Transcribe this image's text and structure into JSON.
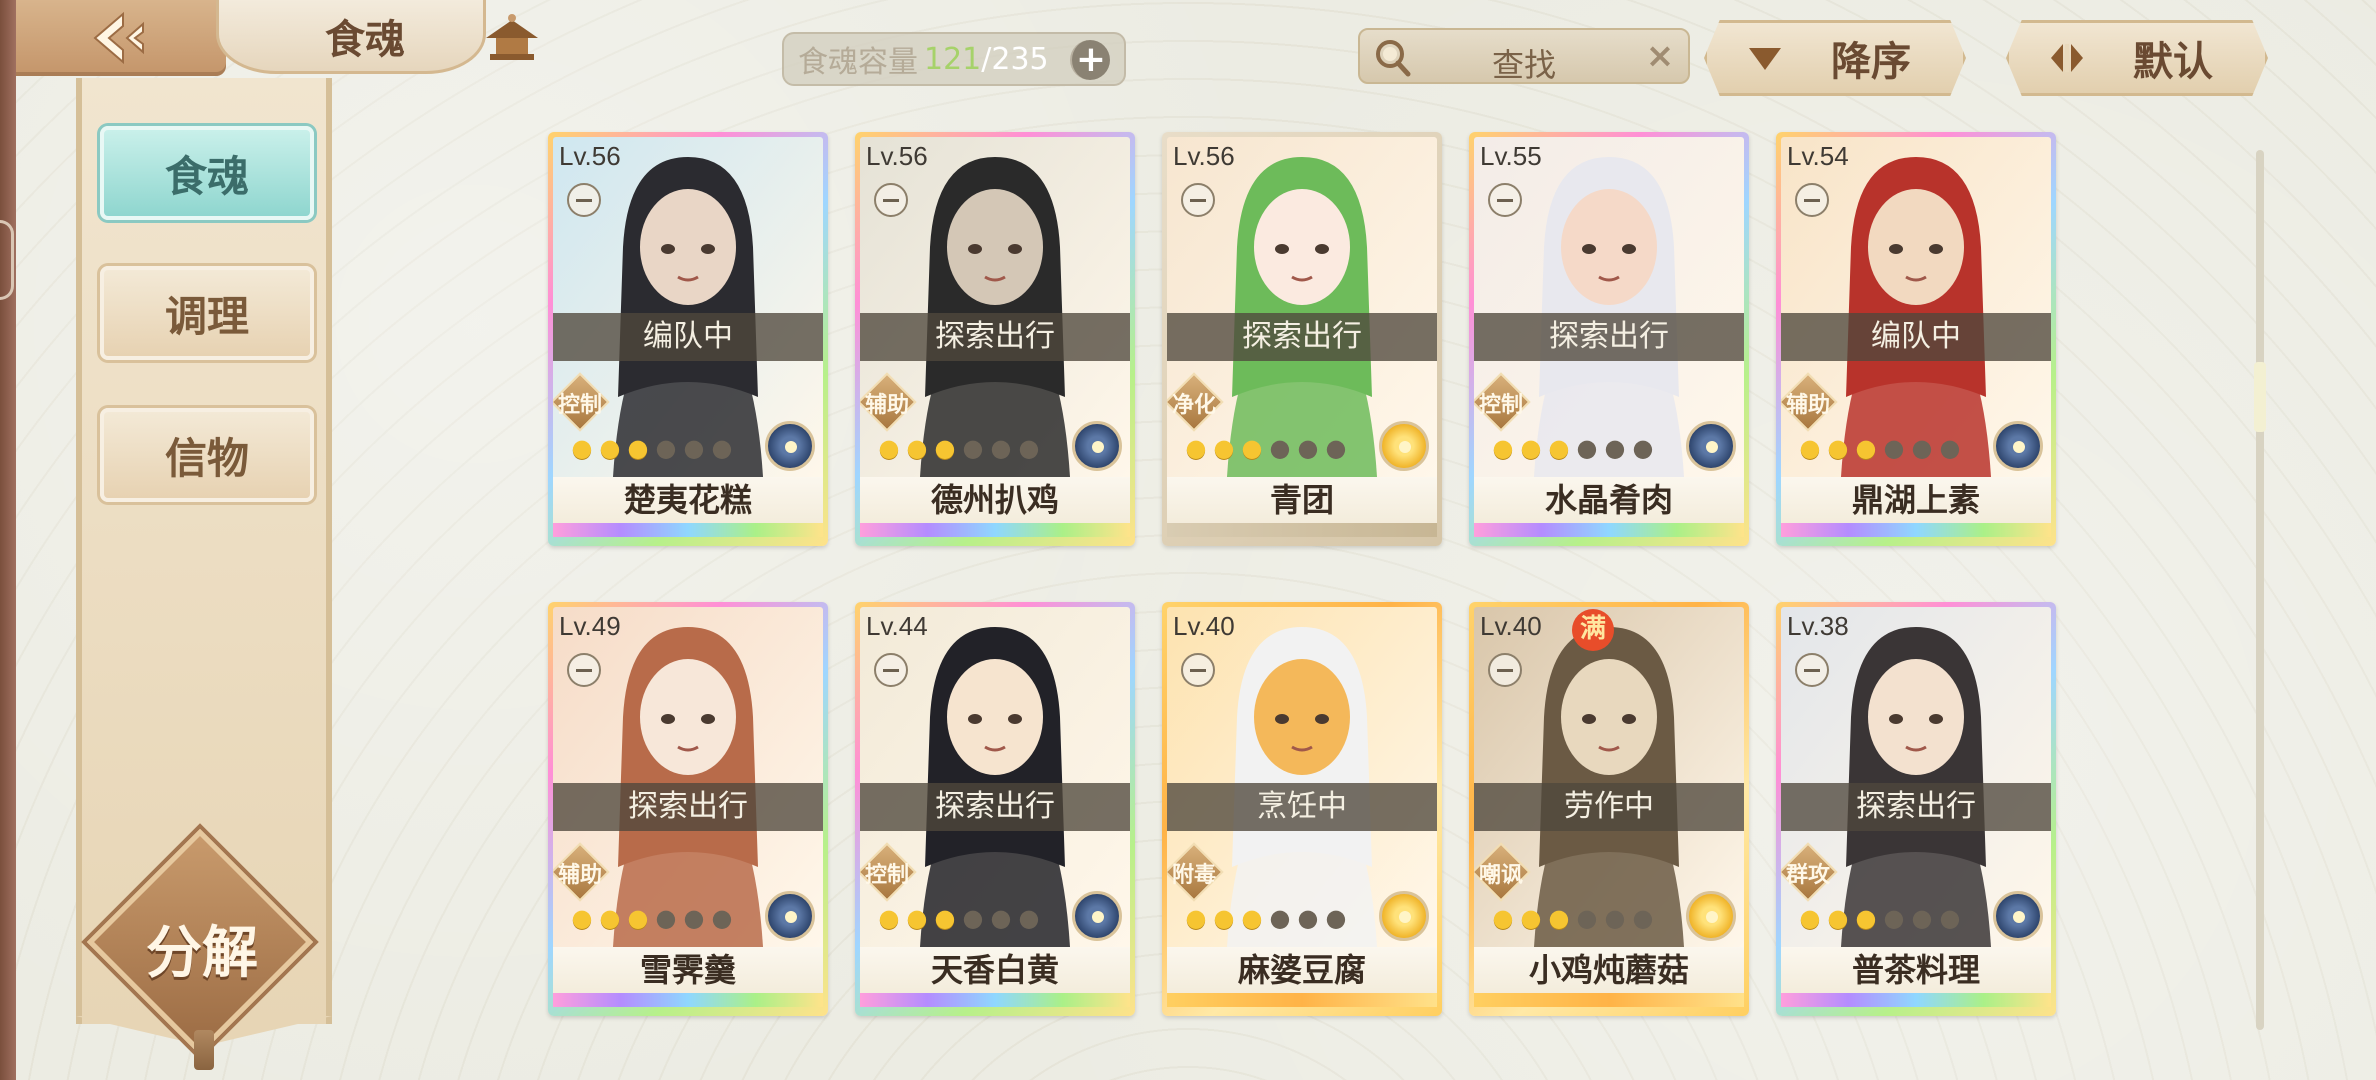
{
  "header": {
    "title": "食魂",
    "capacity_label": "食魂容量",
    "capacity_current": "121",
    "capacity_sep": "/",
    "capacity_max": "235",
    "capacity_add": "+",
    "search_text": "查找",
    "search_clear": "×",
    "sort_order_label": "降序",
    "sort_mode_label": "默认"
  },
  "sidebar": {
    "tabs": [
      {
        "label": "食魂",
        "active": true
      },
      {
        "label": "调理",
        "active": false
      },
      {
        "label": "信物",
        "active": false
      }
    ],
    "decompose_label": "分解"
  },
  "colors": {
    "accent_teal": "#8fd6cf",
    "gold": "#f6c531",
    "capacity_green": "#a6d26a",
    "full_badge": "#e84d2a"
  },
  "cards": [
    {
      "level": "Lv.56",
      "status": "编队中",
      "role": "控制",
      "stars_on": 3,
      "stars_total": 6,
      "element": "blue",
      "name": "楚夷花糕",
      "frame": "rainbow",
      "full": ""
    },
    {
      "level": "Lv.56",
      "status": "探索出行",
      "role": "辅助",
      "stars_on": 3,
      "stars_total": 6,
      "element": "blue",
      "name": "德州扒鸡",
      "frame": "rainbow",
      "full": ""
    },
    {
      "level": "Lv.56",
      "status": "探索出行",
      "role": "净化",
      "stars_on": 3,
      "stars_total": 6,
      "element": "yellow",
      "name": "青团",
      "frame": "plain",
      "full": ""
    },
    {
      "level": "Lv.55",
      "status": "探索出行",
      "role": "控制",
      "stars_on": 3,
      "stars_total": 6,
      "element": "blue",
      "name": "水晶肴肉",
      "frame": "rainbow",
      "full": ""
    },
    {
      "level": "Lv.54",
      "status": "编队中",
      "role": "辅助",
      "stars_on": 3,
      "stars_total": 6,
      "element": "blue",
      "name": "鼎湖上素",
      "frame": "rainbow",
      "full": ""
    },
    {
      "level": "Lv.49",
      "status": "探索出行",
      "role": "辅助",
      "stars_on": 3,
      "stars_total": 6,
      "element": "blue",
      "name": "雪霁羹",
      "frame": "rainbow",
      "full": ""
    },
    {
      "level": "Lv.44",
      "status": "探索出行",
      "role": "控制",
      "stars_on": 3,
      "stars_total": 6,
      "element": "blue",
      "name": "天香白黄",
      "frame": "rainbow",
      "full": ""
    },
    {
      "level": "Lv.40",
      "status": "烹饪中",
      "role": "附毒",
      "stars_on": 3,
      "stars_total": 6,
      "element": "yellow",
      "name": "麻婆豆腐",
      "frame": "gold",
      "full": ""
    },
    {
      "level": "Lv.40",
      "status": "劳作中",
      "role": "嘲讽",
      "stars_on": 3,
      "stars_total": 6,
      "element": "yellow",
      "name": "小鸡炖蘑菇",
      "frame": "gold",
      "full": "满"
    },
    {
      "level": "Lv.38",
      "status": "探索出行",
      "role": "群攻",
      "stars_on": 3,
      "stars_total": 6,
      "element": "blue",
      "name": "普茶料理",
      "frame": "rainbow",
      "full": ""
    }
  ]
}
